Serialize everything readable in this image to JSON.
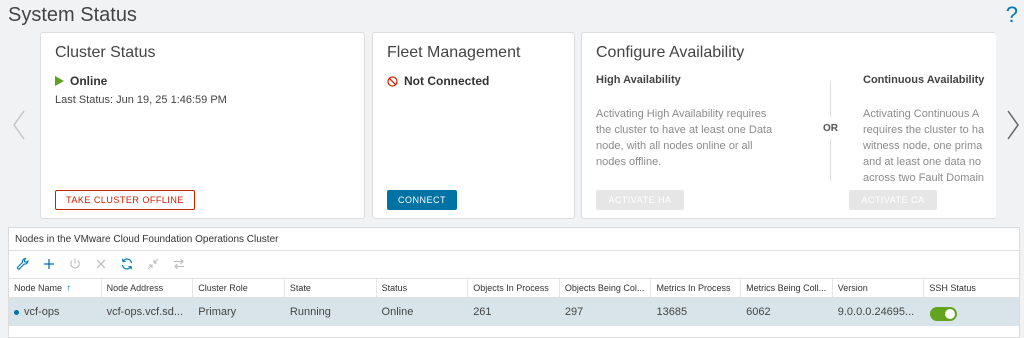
{
  "page": {
    "title": "System Status",
    "help": "?"
  },
  "cluster_status": {
    "title": "Cluster Status",
    "status": "Online",
    "last_status": "Last Status: Jun 19, 25 1:46:59 PM",
    "action": "TAKE CLUSTER OFFLINE"
  },
  "fleet_management": {
    "title": "Fleet Management",
    "status": "Not Connected",
    "action": "CONNECT"
  },
  "availability": {
    "title": "Configure Availability",
    "or": "OR",
    "high": {
      "label": "High Availability",
      "description": "Activating High Availability requires\nthe cluster to have at least one Data\nnode, with all nodes online or all\nnodes offline.",
      "action": "ACTIVATE HA"
    },
    "continuous": {
      "label": "Continuous Availability",
      "description": "Activating Continuous A\nrequires the cluster to ha\nwitness node, one prima\nand at least one data no\nacross two Fault Domain",
      "action": "ACTIVATE CA"
    }
  },
  "nodes": {
    "title": "Nodes in the VMware Cloud Foundation Operations Cluster",
    "toolbar": [
      "wrench-icon",
      "add-icon",
      "power-icon",
      "remove-icon",
      "refresh-icon",
      "collapse-icon",
      "swap-icon"
    ],
    "columns": [
      "Node Name",
      "Node Address",
      "Cluster Role",
      "State",
      "Status",
      "Objects In Process",
      "Objects Being Col...",
      "Metrics In Process",
      "Metrics Being Coll...",
      "Version",
      "SSH Status"
    ],
    "rows": [
      {
        "node_name": "vcf-ops",
        "node_address": "vcf-ops.vcf.sd...",
        "cluster_role": "Primary",
        "state": "Running",
        "status": "Online",
        "objects_in_process": "261",
        "objects_being_collected": "297",
        "metrics_in_process": "13685",
        "metrics_being_collected": "6062",
        "version": "9.0.0.0.24695...",
        "ssh_enabled": true
      }
    ]
  },
  "colors": {
    "accent": "#0072a3",
    "online": "#5aa220",
    "danger": "#c92100",
    "row_selected": "#d9e4ea"
  }
}
